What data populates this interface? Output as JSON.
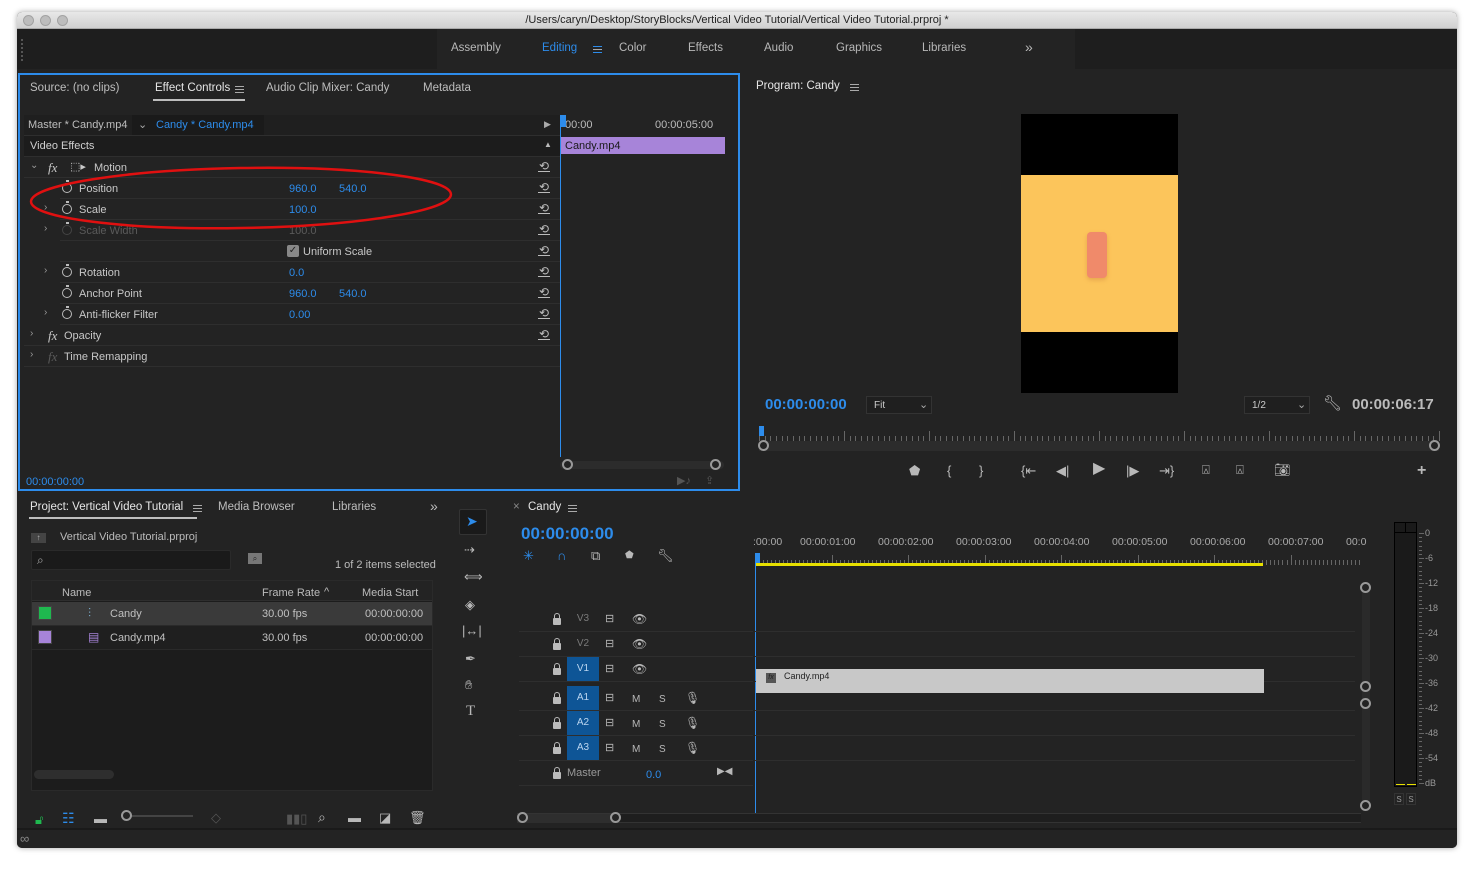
{
  "window": {
    "title": "/Users/caryn/Desktop/StoryBlocks/Vertical Video Tutorial/Vertical Video Tutorial.prproj *"
  },
  "workspaces": {
    "items": [
      "Assembly",
      "Editing",
      "Color",
      "Effects",
      "Audio",
      "Graphics",
      "Libraries"
    ],
    "active": "Editing",
    "overflow_icon": "double-chevron-right-icon"
  },
  "effect_controls_panel": {
    "tabs": [
      "Source: (no clips)",
      "Effect Controls",
      "Audio Clip Mixer: Candy",
      "Metadata"
    ],
    "active_tab": "Effect Controls",
    "master_label": "Master * Candy.mp4",
    "clip_label": "Candy * Candy.mp4",
    "section": "Video Effects",
    "effects": [
      {
        "name": "Motion",
        "kind": "fx-group",
        "expanded": true
      },
      {
        "name": "Position",
        "values": [
          "960.0",
          "540.0"
        ],
        "disabled": false,
        "expandable": false
      },
      {
        "name": "Scale",
        "values": [
          "100.0"
        ],
        "disabled": false,
        "expandable": true
      },
      {
        "name": "Scale Width",
        "values": [
          "100.0"
        ],
        "disabled": true,
        "expandable": true
      },
      {
        "name": "Uniform Scale",
        "kind": "checkbox",
        "checked": true
      },
      {
        "name": "Rotation",
        "values": [
          "0.0"
        ],
        "disabled": false,
        "expandable": true
      },
      {
        "name": "Anchor Point",
        "values": [
          "960.0",
          "540.0"
        ],
        "disabled": false,
        "expandable": false
      },
      {
        "name": "Anti-flicker Filter",
        "values": [
          "0.00"
        ],
        "disabled": false,
        "expandable": true
      },
      {
        "name": "Opacity",
        "kind": "fx-group",
        "expanded": false
      },
      {
        "name": "Time Remapping",
        "kind": "fx-group",
        "expanded": false,
        "disabled": true
      }
    ],
    "mini_timeline": {
      "ruler_start": "00:00",
      "ruler_mid": "00:00:05:00",
      "clip_name": "Candy.mp4",
      "clip_color": "#a784d9"
    },
    "timecode": "00:00:00:00",
    "annotation": "red ellipse highlighting Position and Scale"
  },
  "program_monitor": {
    "title": "Program: Candy",
    "timecode": "00:00:00:00",
    "zoom_select": "Fit",
    "resolution_select": "1/2",
    "duration": "00:00:06:17",
    "frame_colors": {
      "letterbox": "#000000",
      "background": "#fcc55b",
      "subject": "#f08a6a"
    },
    "transport_buttons": [
      "add-marker",
      "mark-in",
      "mark-out",
      "go-to-in",
      "step-back",
      "play",
      "step-forward",
      "go-to-out",
      "lift",
      "extract",
      "export-frame",
      "add-button"
    ]
  },
  "project_panel": {
    "tabs": [
      "Project: Vertical Video Tutorial",
      "Media Browser",
      "Libraries"
    ],
    "active_tab": "Project: Vertical Video Tutorial",
    "project_file": "Vertical Video Tutorial.prproj",
    "search_placeholder": "",
    "selection_status": "1 of 2 items selected",
    "columns": [
      "Name",
      "Frame Rate",
      "Media Start"
    ],
    "sort_column": "Frame Rate",
    "items": [
      {
        "label_color": "#1fb84f",
        "type": "sequence",
        "name": "Candy",
        "frame_rate": "30.00 fps",
        "media_start": "00:00:00:00",
        "selected": true
      },
      {
        "label_color": "#a784d9",
        "type": "clip",
        "name": "Candy.mp4",
        "frame_rate": "30.00 fps",
        "media_start": "00:00:00:00",
        "selected": false
      }
    ]
  },
  "tools": [
    "selection",
    "track-select-forward",
    "ripple-edit",
    "razor",
    "slip",
    "pen",
    "hand",
    "type"
  ],
  "timeline": {
    "sequence_name": "Candy",
    "timecode": "00:00:00:00",
    "ruler_labels": [
      ":00:00",
      "00:00:01:00",
      "00:00:02:00",
      "00:00:03:00",
      "00:00:04:00",
      "00:00:05:00",
      "00:00:06:00",
      "00:00:07:00",
      "00:0"
    ],
    "work_area_color": "#e8e000",
    "video_tracks": [
      {
        "name": "V3",
        "targeted": false
      },
      {
        "name": "V2",
        "targeted": false
      },
      {
        "name": "V1",
        "targeted": true
      }
    ],
    "audio_tracks": [
      {
        "name": "A1",
        "m": "M",
        "s": "S"
      },
      {
        "name": "A2",
        "m": "M",
        "s": "S"
      },
      {
        "name": "A3",
        "m": "M",
        "s": "S"
      }
    ],
    "master": {
      "label": "Master",
      "value": "0.0"
    },
    "clips": [
      {
        "name": "Candy.mp4",
        "track": "V1",
        "start_sec": 0,
        "end_sec": 6.57
      }
    ]
  },
  "audio_meter": {
    "scale": [
      "0",
      "-6",
      "-12",
      "-18",
      "-24",
      "-30",
      "-36",
      "-42",
      "-48",
      "-54",
      "dB"
    ],
    "solo_buttons": [
      "S",
      "S"
    ]
  }
}
